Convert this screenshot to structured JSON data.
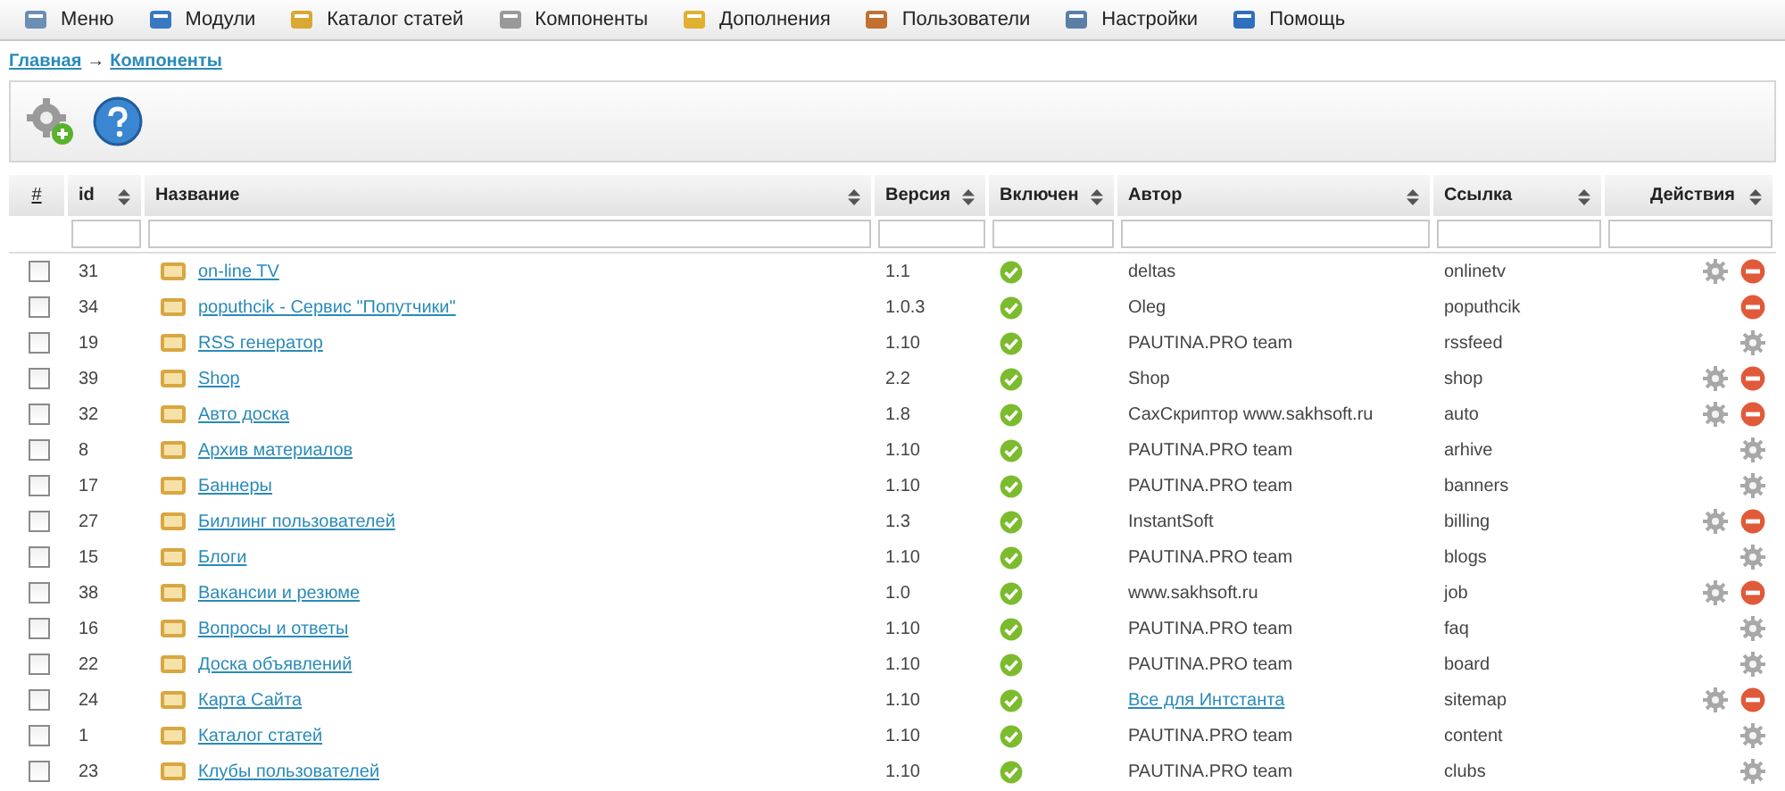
{
  "menu": [
    {
      "label": "Меню"
    },
    {
      "label": "Модули"
    },
    {
      "label": "Каталог статей"
    },
    {
      "label": "Компоненты"
    },
    {
      "label": "Дополнения"
    },
    {
      "label": "Пользователи"
    },
    {
      "label": "Настройки"
    },
    {
      "label": "Помощь"
    }
  ],
  "breadcrumb": {
    "home": "Главная",
    "separator": "→",
    "current": "Компоненты"
  },
  "table": {
    "columns": [
      {
        "label": "#",
        "sortable": false
      },
      {
        "label": "id",
        "sortable": true
      },
      {
        "label": "Название",
        "sortable": true
      },
      {
        "label": "Версия",
        "sortable": true
      },
      {
        "label": "Включен",
        "sortable": true
      },
      {
        "label": "Автор",
        "sortable": true
      },
      {
        "label": "Ссылка",
        "sortable": true
      },
      {
        "label": "Действия",
        "sortable": true
      }
    ],
    "rows": [
      {
        "checked": false,
        "id": "31",
        "name": "on-line TV",
        "version": "1.1",
        "enabled": true,
        "author": "deltas",
        "author_link": false,
        "link": "onlinetv",
        "config": true,
        "delete": true
      },
      {
        "checked": false,
        "id": "34",
        "name": "poputhcik - Сервис \"Попутчики\"",
        "version": "1.0.3",
        "enabled": true,
        "author": "Oleg",
        "author_link": false,
        "link": "poputhcik",
        "config": false,
        "delete": true
      },
      {
        "checked": false,
        "id": "19",
        "name": "RSS генератор",
        "version": "1.10",
        "enabled": true,
        "author": "PAUTINA.PRO team",
        "author_link": false,
        "link": "rssfeed",
        "config": true,
        "delete": false
      },
      {
        "checked": false,
        "id": "39",
        "name": "Shop",
        "version": "2.2",
        "enabled": true,
        "author": "Shop",
        "author_link": false,
        "link": "shop",
        "config": true,
        "delete": true
      },
      {
        "checked": false,
        "id": "32",
        "name": "Авто доска",
        "version": "1.8",
        "enabled": true,
        "author": "СахСкриптор www.sakhsoft.ru",
        "author_link": false,
        "link": "auto",
        "config": true,
        "delete": true
      },
      {
        "checked": false,
        "id": "8",
        "name": "Архив материалов",
        "version": "1.10",
        "enabled": true,
        "author": "PAUTINA.PRO team",
        "author_link": false,
        "link": "arhive",
        "config": true,
        "delete": false
      },
      {
        "checked": false,
        "id": "17",
        "name": "Баннеры",
        "version": "1.10",
        "enabled": true,
        "author": "PAUTINA.PRO team",
        "author_link": false,
        "link": "banners",
        "config": true,
        "delete": false
      },
      {
        "checked": false,
        "id": "27",
        "name": "Биллинг пользователей",
        "version": "1.3",
        "enabled": true,
        "author": "InstantSoft",
        "author_link": false,
        "link": "billing",
        "config": true,
        "delete": true
      },
      {
        "checked": false,
        "id": "15",
        "name": "Блоги",
        "version": "1.10",
        "enabled": true,
        "author": "PAUTINA.PRO team",
        "author_link": false,
        "link": "blogs",
        "config": true,
        "delete": false
      },
      {
        "checked": false,
        "id": "38",
        "name": "Вакансии и резюме",
        "version": "1.0",
        "enabled": true,
        "author": "www.sakhsoft.ru",
        "author_link": false,
        "link": "job",
        "config": true,
        "delete": true
      },
      {
        "checked": false,
        "id": "16",
        "name": "Вопросы и ответы",
        "version": "1.10",
        "enabled": true,
        "author": "PAUTINA.PRO team",
        "author_link": false,
        "link": "faq",
        "config": true,
        "delete": false
      },
      {
        "checked": false,
        "id": "22",
        "name": "Доска объявлений",
        "version": "1.10",
        "enabled": true,
        "author": "PAUTINA.PRO team",
        "author_link": false,
        "link": "board",
        "config": true,
        "delete": false
      },
      {
        "checked": false,
        "id": "24",
        "name": "Карта Сайта",
        "version": "1.10",
        "enabled": true,
        "author": "Все для Интстанта",
        "author_link": true,
        "link": "sitemap",
        "config": true,
        "delete": true
      },
      {
        "checked": false,
        "id": "1",
        "name": "Каталог статей",
        "version": "1.10",
        "enabled": true,
        "author": "PAUTINA.PRO team",
        "author_link": false,
        "link": "content",
        "config": true,
        "delete": false
      },
      {
        "checked": false,
        "id": "23",
        "name": "Клубы пользователей",
        "version": "1.10",
        "enabled": true,
        "author": "PAUTINA.PRO team",
        "author_link": false,
        "link": "clubs",
        "config": true,
        "delete": false
      }
    ]
  }
}
